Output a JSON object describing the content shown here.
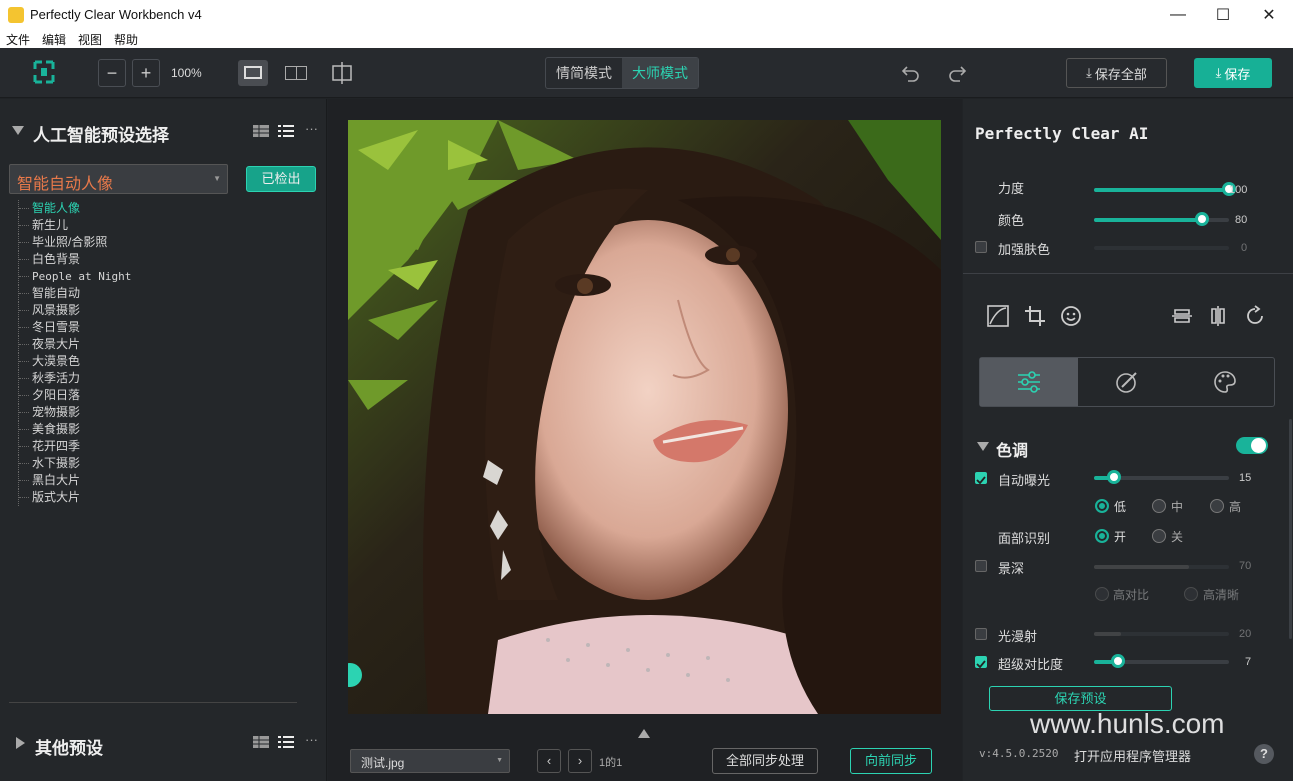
{
  "window": {
    "title": "Perfectly Clear Workbench v4",
    "minimize": "—",
    "maximize": "☐",
    "close": "✕"
  },
  "menu": [
    "文件",
    "编辑",
    "视图",
    "帮助"
  ],
  "toolbar": {
    "zoom_out": "−",
    "zoom_in": "+",
    "zoom_level": "100%",
    "modes": [
      "情简模式",
      "大师模式"
    ],
    "active_mode": "大师模式",
    "save_all": "保存全部",
    "save": "保存",
    "accent": "#19b39a"
  },
  "left": {
    "ai_section": "人工智能预设选择",
    "selected_preset": "智能自动人像",
    "checked_out": "已检出",
    "presets": [
      "智能人像",
      "新生儿",
      "毕业照/合影照",
      "白色背景",
      "People at Night",
      "智能自动",
      "风景摄影",
      "冬日雪景",
      "夜景大片",
      "大漠景色",
      "秋季活力",
      "夕阳日落",
      "宠物摄影",
      "美食摄影",
      "花开四季",
      "水下摄影",
      "黑白大片",
      "版式大片"
    ],
    "other_section": "其他预设"
  },
  "center": {
    "file": "测试.jpg",
    "page": "1的1",
    "sync_all": "全部同步处理",
    "sync_forward": "向前同步"
  },
  "right": {
    "title": "Perfectly Clear AI",
    "strength": {
      "label": "力度",
      "value": "100",
      "frac": 1.0
    },
    "color": {
      "label": "颜色",
      "value": "80",
      "frac": 0.8
    },
    "enhance_skin": {
      "label": "加强肤色",
      "value": "0",
      "frac": 0
    },
    "tone_section": "色调",
    "auto_exposure": {
      "label": "自动曝光",
      "value": "15",
      "frac": 0.15
    },
    "exposure_levels": [
      "低",
      "中",
      "高"
    ],
    "face_detect": {
      "label": "面部识别",
      "on": "开",
      "off": "关"
    },
    "depth": {
      "label": "景深",
      "value": "70",
      "frac": 0.7
    },
    "depth_opts": [
      "高对比",
      "高清晰"
    ],
    "light_diffuse": {
      "label": "光漫射",
      "value": "20",
      "frac": 0.2
    },
    "super_contrast": {
      "label": "超级对比度",
      "value": "7",
      "frac": 0.18
    },
    "save_preset": "保存预设",
    "version": "v:4.5.0.2520",
    "app_manager": "打开应用程序管理器",
    "watermark": "www.hunls.com",
    "help": "?"
  }
}
